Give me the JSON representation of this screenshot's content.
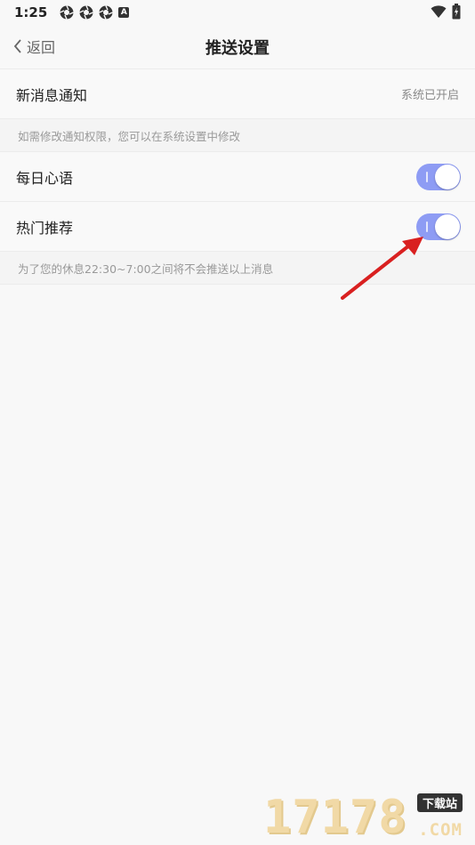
{
  "status_bar": {
    "time": "1:25",
    "left_icons": [
      "aperture-icon",
      "aperture-icon",
      "aperture-icon",
      "app-a-icon"
    ],
    "badge_letter": "A",
    "right_icons": [
      "wifi-icon",
      "battery-charging-icon"
    ]
  },
  "nav": {
    "back_label": "返回",
    "title": "推送设置"
  },
  "settings": {
    "notification": {
      "label": "新消息通知",
      "value": "系统已开启"
    },
    "notification_hint": "如需修改通知权限，您可以在系统设置中修改",
    "daily_quote": {
      "label": "每日心语",
      "enabled": true
    },
    "hot_recommend": {
      "label": "热门推荐",
      "enabled": true
    },
    "quiet_hint": "为了您的休息22:30~7:00之间将不会推送以上消息"
  },
  "colors": {
    "toggle_on": "#8e9cf4",
    "annotation_arrow": "#d92020"
  },
  "watermark": {
    "digits": "17178",
    "tag": "下载站",
    "suffix": ".COM"
  }
}
